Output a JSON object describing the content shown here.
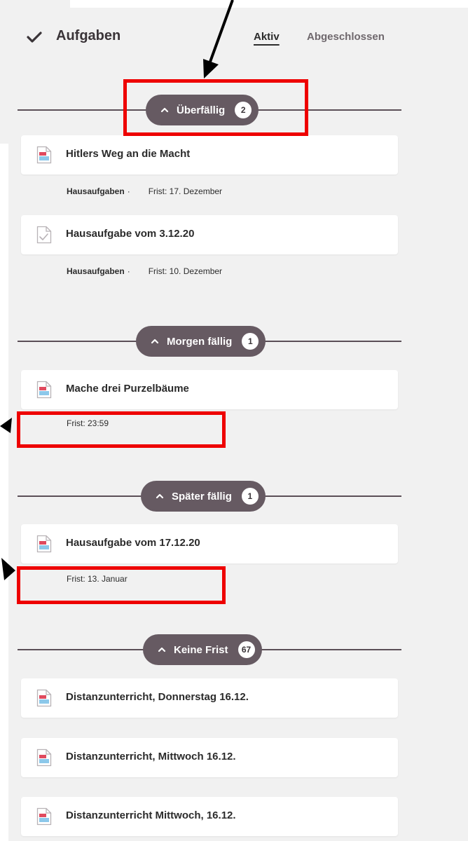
{
  "header": {
    "title": "Aufgaben",
    "tabs": [
      {
        "label": "Aktiv",
        "active": true
      },
      {
        "label": "Abgeschlossen",
        "active": false
      }
    ]
  },
  "sections": [
    {
      "label": "Überfällig",
      "count": "2",
      "tasks": [
        {
          "title": "Hitlers Weg an die Macht",
          "icon": "document-icon",
          "category": "Hausaufgaben",
          "separator": "·",
          "due": "Frist: 17. Dezember"
        },
        {
          "title": "Hausaufgabe vom 3.12.20",
          "icon": "document-check-icon",
          "category": "Hausaufgaben",
          "separator": "·",
          "due": "Frist: 10. Dezember"
        }
      ]
    },
    {
      "label": "Morgen fällig",
      "count": "1",
      "tasks": [
        {
          "title": "Mache drei Purzelbäume",
          "icon": "document-icon",
          "due": "Frist: 23:59"
        }
      ]
    },
    {
      "label": "Später fällig",
      "count": "1",
      "tasks": [
        {
          "title": "Hausaufgabe vom 17.12.20",
          "icon": "document-icon",
          "due": "Frist: 13. Januar"
        }
      ]
    },
    {
      "label": "Keine Frist",
      "count": "67",
      "tasks": [
        {
          "title": "Distanzunterricht, Donnerstag 16.12.",
          "icon": "document-icon"
        },
        {
          "title": "Distanzunterricht, Mittwoch 16.12.",
          "icon": "document-icon"
        },
        {
          "title": "Distanzunterricht Mittwoch, 16.12.",
          "icon": "document-icon"
        }
      ]
    }
  ],
  "colors": {
    "pill": "#665a62",
    "divider": "#5b4f57",
    "annotation": "#ee0000",
    "panel": "#f1f1f1"
  }
}
